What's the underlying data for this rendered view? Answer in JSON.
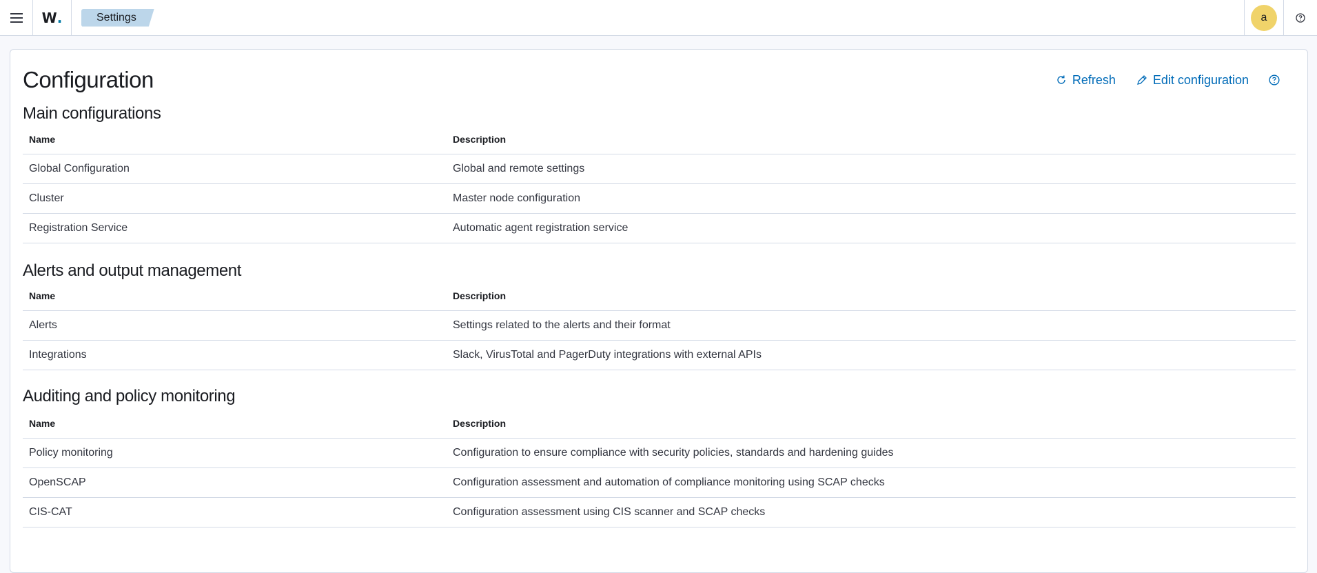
{
  "topbar": {
    "logo": "W",
    "breadcrumb": "Settings",
    "avatar_initial": "a"
  },
  "page": {
    "title": "Configuration",
    "actions": {
      "refresh": "Refresh",
      "edit": "Edit configuration"
    }
  },
  "sections": [
    {
      "title": "Main configurations",
      "columns": [
        "Name",
        "Description"
      ],
      "rows": [
        {
          "name": "Global Configuration",
          "description": "Global and remote settings"
        },
        {
          "name": "Cluster",
          "description": "Master node configuration"
        },
        {
          "name": "Registration Service",
          "description": "Automatic agent registration service"
        }
      ]
    },
    {
      "title": "Alerts and output management",
      "columns": [
        "Name",
        "Description"
      ],
      "rows": [
        {
          "name": "Alerts",
          "description": "Settings related to the alerts and their format"
        },
        {
          "name": "Integrations",
          "description": "Slack, VirusTotal and PagerDuty integrations with external APIs"
        }
      ]
    },
    {
      "title": "Auditing and policy monitoring",
      "columns": [
        "Name",
        "Description"
      ],
      "rows": [
        {
          "name": "Policy monitoring",
          "description": "Configuration to ensure compliance with security policies, standards and hardening guides"
        },
        {
          "name": "OpenSCAP",
          "description": "Configuration assessment and automation of compliance monitoring using SCAP checks"
        },
        {
          "name": "CIS-CAT",
          "description": "Configuration assessment using CIS scanner and SCAP checks"
        }
      ]
    }
  ],
  "colors": {
    "accent": "#006bb8",
    "breadcrumb_bg": "#bcd6ea",
    "avatar_bg": "#f0d36a",
    "border": "#d3dae6"
  }
}
